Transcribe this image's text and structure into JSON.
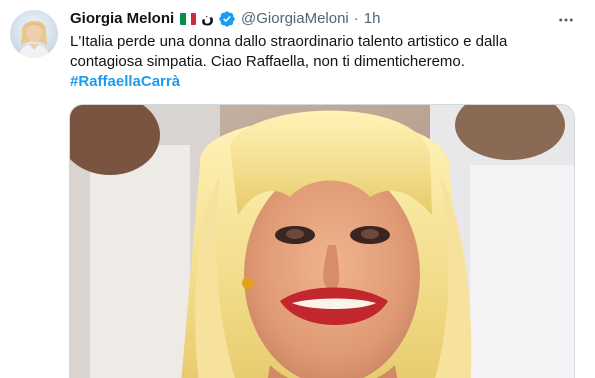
{
  "tweet": {
    "author": {
      "name": "Giorgia Meloni",
      "flag": "italian-flag",
      "extra_char": "ن",
      "verified": true,
      "handle": "@GiorgiaMeloni",
      "separator": "·",
      "time": "1h"
    },
    "text_line": "L'Italia perde una donna dallo straordinario talento artistico e dalla contagiosa simpatia. Ciao Raffaella, non ti dimenticheremo.",
    "hashtag": "#RaffaellaCarrà",
    "media": {
      "type": "photo",
      "subject": "smiling woman with blonde hair and bangs"
    }
  },
  "colors": {
    "text_primary": "#0f1419",
    "text_secondary": "#536471",
    "accent": "#1d9bf0",
    "border": "#cfd9de"
  },
  "icons": {
    "verified": "verified-badge-icon",
    "more": "more-horizontal-icon"
  }
}
